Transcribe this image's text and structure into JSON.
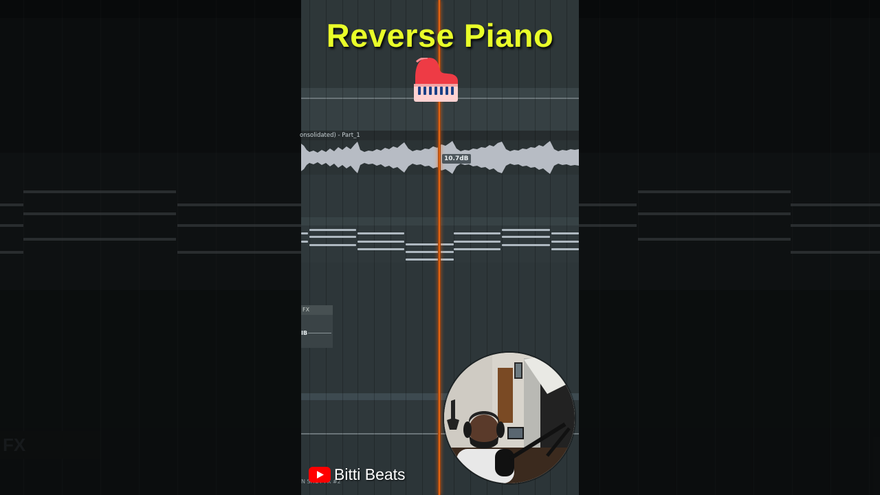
{
  "overlay": {
    "title": "Reverse Piano",
    "channel_name": "Bitti Beats",
    "icon": "grand-piano-emoji-icon",
    "brand_icon": "youtube-icon",
    "title_color": "#e9ff29"
  },
  "daw": {
    "clip_label": "onsolidated) - Part_1",
    "gain_badge": "10.7dB",
    "fx_track_label": "FX",
    "fx_gain_label": "IB",
    "bottom_clip_label": "N SHOT FX #2",
    "ghost_fx_label": "FX",
    "playhead_color": "#ff7a1e"
  },
  "webcam": {
    "description_icon": "webcam-person-icon"
  }
}
